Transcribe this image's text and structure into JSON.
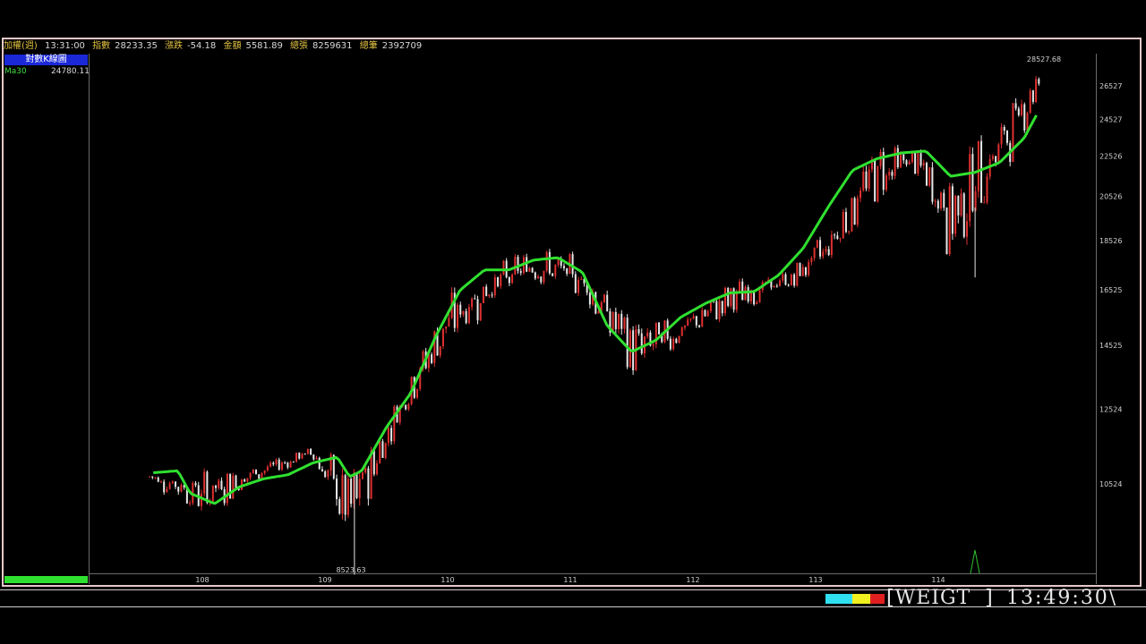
{
  "infobar": {
    "name": "加權(週)",
    "time": "13:31:00",
    "index_label": "指數",
    "index_value": "28233.35",
    "change_label": "漲跌",
    "change_value": "-54.18",
    "amount_label": "金額",
    "amount_value": "5581.89",
    "volume_label": "總張",
    "volume_value": "8259631",
    "trades_label": "總筆",
    "trades_value": "2392709"
  },
  "panel": {
    "title": "對數K線圖",
    "ma_label": "Ma30",
    "ma_value": "24780.11"
  },
  "status": {
    "text": "[WEIGT  ]",
    "clock": "13:49:30\\",
    "colors": [
      "#30e0f0",
      "#f0f020",
      "#e02020"
    ]
  },
  "chart_data": {
    "type": "candlestick",
    "scale": "log",
    "y_ticks": [
      26527,
      24527,
      22526,
      20526,
      18526,
      16525,
      14525,
      12524,
      10524
    ],
    "y_tick_labels": [
      "26527",
      "24527",
      "22526",
      "20526",
      "18526",
      "16525",
      "14525",
      "12524",
      "10524"
    ],
    "x_tick_labels": [
      "108",
      "109",
      "110",
      "111",
      "112",
      "113",
      "114"
    ],
    "high_label": "28527.68",
    "low_label": "8523.63",
    "ylim": [
      8523.63,
      28527.68
    ],
    "colors": {
      "up": "#e03030",
      "down": "#e8e8e8",
      "ma": "#30e030"
    },
    "series": [
      {
        "name": "Ma30",
        "x": [
          107.6,
          107.8,
          107.9,
          108.1,
          108.3,
          108.5,
          108.7,
          108.9,
          109.1,
          109.2,
          109.3,
          109.5,
          109.7,
          109.9,
          110.1,
          110.3,
          110.5,
          110.7,
          110.9,
          111.1,
          111.3,
          111.5,
          111.7,
          111.9,
          112.1,
          112.3,
          112.5,
          112.7,
          112.9,
          113.1,
          113.3,
          113.5,
          113.7,
          113.9,
          114.1,
          114.3,
          114.5,
          114.7,
          114.8
        ],
        "values": [
          10800,
          10850,
          10300,
          10050,
          10450,
          10650,
          10750,
          11050,
          11200,
          10700,
          10850,
          12000,
          13000,
          14800,
          16500,
          17300,
          17300,
          17700,
          17800,
          17200,
          15200,
          14300,
          14700,
          15500,
          16000,
          16400,
          16450,
          17100,
          18200,
          20000,
          21800,
          22400,
          22700,
          22800,
          21500,
          21700,
          22200,
          23500,
          24780.11
        ]
      }
    ],
    "candles_low_high_range": [
      {
        "x": 107.6,
        "low": 10400,
        "high": 11000
      },
      {
        "x": 108.0,
        "low": 9600,
        "high": 11000
      },
      {
        "x": 108.4,
        "low": 10400,
        "high": 11100
      },
      {
        "x": 108.9,
        "low": 11100,
        "high": 11600
      },
      {
        "x": 109.2,
        "low": 8523.63,
        "high": 11300
      },
      {
        "x": 109.6,
        "low": 12100,
        "high": 13000
      },
      {
        "x": 110.0,
        "low": 14000,
        "high": 16700
      },
      {
        "x": 110.4,
        "low": 16000,
        "high": 17700
      },
      {
        "x": 110.7,
        "low": 16700,
        "high": 18400
      },
      {
        "x": 111.1,
        "low": 16000,
        "high": 17900
      },
      {
        "x": 111.5,
        "low": 13100,
        "high": 15800
      },
      {
        "x": 111.9,
        "low": 14400,
        "high": 15600
      },
      {
        "x": 112.3,
        "low": 15400,
        "high": 17000
      },
      {
        "x": 112.8,
        "low": 16300,
        "high": 17500
      },
      {
        "x": 113.1,
        "low": 17300,
        "high": 19500
      },
      {
        "x": 113.5,
        "low": 20000,
        "high": 24000
      },
      {
        "x": 113.8,
        "low": 21500,
        "high": 23200
      },
      {
        "x": 114.1,
        "low": 17000,
        "high": 22500
      },
      {
        "x": 114.5,
        "low": 21000,
        "high": 25000
      },
      {
        "x": 114.8,
        "low": 25000,
        "high": 28527.68
      }
    ]
  }
}
